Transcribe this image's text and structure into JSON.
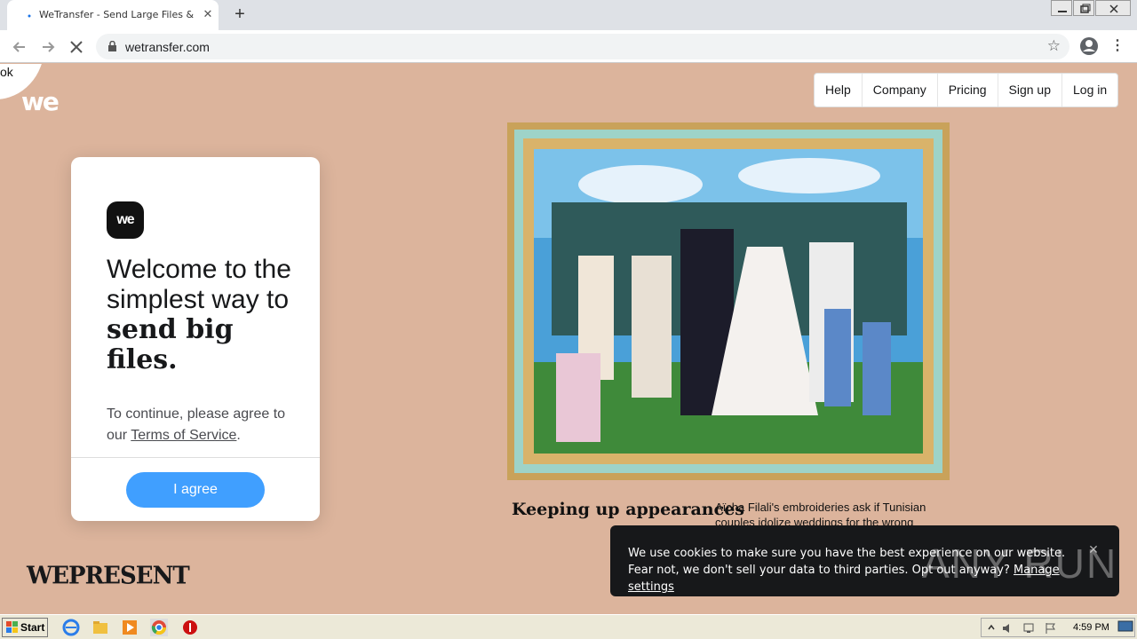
{
  "browser": {
    "tab_title": "WeTransfer - Send Large Files & Sha",
    "url": "wetransfer.com"
  },
  "page": {
    "corner_text": "ok",
    "we_logo": "we",
    "nav": [
      "Help",
      "Company",
      "Pricing",
      "Sign up",
      "Log in"
    ],
    "card": {
      "logo": "we",
      "heading_plain": "Welcome to the simplest way to",
      "heading_bold": "send big files.",
      "text_before": "To continue, please agree to our",
      "terms_link": "Terms of Service",
      "text_after": ".",
      "agree_label": "I agree"
    },
    "wepresent": "WEPRESENT",
    "caption_title": "Keeping up appearances",
    "caption_text": "Aïcha Filali's embroideries ask if Tunisian couples idolize weddings for the wrong",
    "cookie": {
      "text": "We use cookies to make sure you have the best experience on our website. Fear not, we don't sell your data to third parties. Opt out anyway?",
      "link": "Manage settings",
      "close": "✕"
    },
    "watermark": "ANY RUN"
  },
  "taskbar": {
    "start_label": "Start",
    "clock": "4:59 PM"
  }
}
